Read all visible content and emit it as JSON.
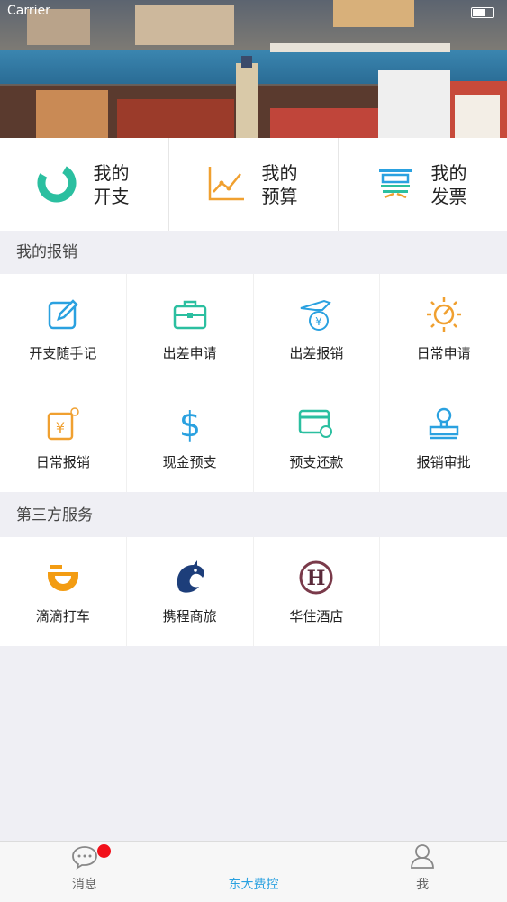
{
  "status_bar": {
    "carrier": "Carrier"
  },
  "top_cards": [
    {
      "line1": "我的",
      "line2": "开支",
      "icon": "pie-chart-icon"
    },
    {
      "line1": "我的",
      "line2": "预算",
      "icon": "line-chart-icon"
    },
    {
      "line1": "我的",
      "line2": "发票",
      "icon": "invoice-icon"
    }
  ],
  "reimburse_section": {
    "title": "我的报销",
    "items": [
      {
        "label": "开支随手记",
        "icon": "edit-icon"
      },
      {
        "label": "出差申请",
        "icon": "briefcase-icon"
      },
      {
        "label": "出差报销",
        "icon": "plane-yen-icon"
      },
      {
        "label": "日常申请",
        "icon": "sun-gauge-icon"
      },
      {
        "label": "日常报销",
        "icon": "yen-sun-icon"
      },
      {
        "label": "现金预支",
        "icon": "dollar-icon"
      },
      {
        "label": "预支还款",
        "icon": "card-icon"
      },
      {
        "label": "报销审批",
        "icon": "stamp-icon"
      }
    ]
  },
  "third_party_section": {
    "title": "第三方服务",
    "items": [
      {
        "label": "滴滴打车",
        "icon": "didi-icon"
      },
      {
        "label": "携程商旅",
        "icon": "ctrip-dolphin-icon"
      },
      {
        "label": "华住酒店",
        "icon": "huazhu-icon"
      }
    ]
  },
  "hotel_logo_letter": "H",
  "tabbar": {
    "items": [
      {
        "label": "消息",
        "icon": "chat-bubble-icon"
      },
      {
        "label": "东大费控",
        "icon": ""
      },
      {
        "label": "我",
        "icon": "person-icon"
      }
    ],
    "active_index": 1
  },
  "colors": {
    "blue": "#2aa1e0",
    "teal": "#2bbfa0",
    "orange": "#f0a030",
    "badge": "#f2101a"
  }
}
